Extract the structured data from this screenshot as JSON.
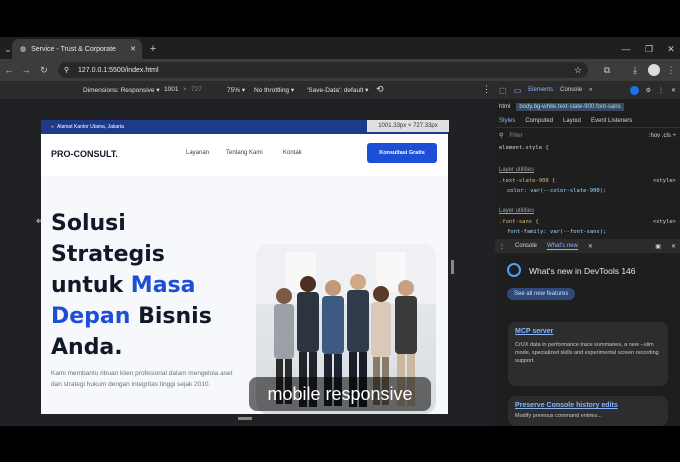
{
  "browser": {
    "tab_title": "Service - Trust & Corporate",
    "url": "127.0.0.1:5500/index.html"
  },
  "device_toolbar": {
    "dimensions": "Dimensions: Responsive ▾",
    "width": "1001",
    "height": "727",
    "zoom": "75% ▾",
    "throttling": "No throttling ▾",
    "save_data": "'Save-Data': default ▾",
    "size_badge": "1001.33px × 727.33px"
  },
  "page": {
    "top_address": "Alamat Kantor Utama, Jakarta",
    "logo": "PRO-CONSULT.",
    "nav": [
      "Layanan",
      "Tentang Kami",
      "Kontak"
    ],
    "cta": "Konsultasi Gratis",
    "hero": {
      "l1": "Solusi",
      "l2": "Strategis",
      "l3a": "untuk ",
      "l3b": "Masa",
      "l4a": "Depan",
      "l4b": " Bisnis",
      "l5": "Anda."
    },
    "description": "Kami membantu ribuan klien profesional dalam mengelola aset dan strategi hukum dengan integritas tinggi sejak 2010."
  },
  "overlay_caption": "mobile responsive",
  "devtools": {
    "breadcrumb_html": "html",
    "breadcrumb_body": "body.bg-white.text-slate-900.font-sans",
    "tabs_top": [
      "Elements",
      "Console"
    ],
    "tabs_styles": [
      "Styles",
      "Computed",
      "Layout",
      "Event Listeners"
    ],
    "filter_placeholder": "Filter",
    "filter_opts": ":hov  .cls  +",
    "element_style": "element.style {",
    "layer1": "Layer utilities",
    "rule1_sel": ".text-slate-900 {",
    "rule1_prop": "color: var(--color-slate-900);",
    "style_src": "<style>",
    "layer2": "Layer utilities",
    "rule2_sel": ".font-sans {",
    "rule2_prop": "font-family: var(--font-sans);",
    "drawer_tabs": [
      "Console",
      "What's new"
    ],
    "whats_new_title": "What's new in DevTools 146",
    "see_all": "See all new features",
    "cards": [
      {
        "title": "MCP server",
        "body": "CrUX data in performance trace summaries, a new --slim mode, specialized skills and experimental screen recording support."
      },
      {
        "title": "Preserve Console history edits",
        "body": "Modify previous command entries..."
      }
    ]
  },
  "colors": {
    "brand_blue": "#1d4ed8",
    "strip_blue": "#1e3a8a",
    "devtools_bg": "#1e1e1e"
  }
}
